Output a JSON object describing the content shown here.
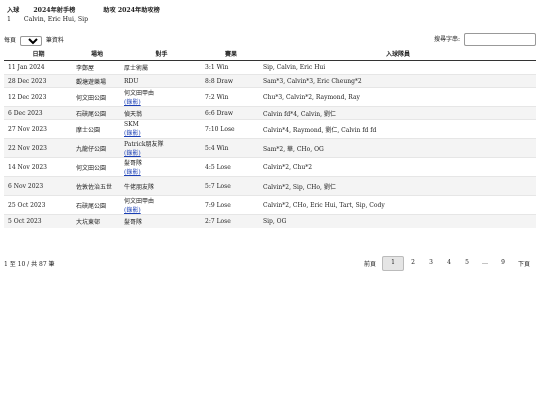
{
  "header": {
    "tab_goals": "入球",
    "tab_scorers": "2024年射手榜",
    "tab_assists": "助攻 2024年助攻榜",
    "rank": "1",
    "leaders": "Calvin, Eric Hui, Sip"
  },
  "controls": {
    "show_prefix": "每頁",
    "page_size": "10",
    "show_suffix": "筆資料",
    "search_label": "搜尋字串:"
  },
  "table": {
    "headers": [
      "日期",
      "場地",
      "對手",
      "賽果",
      "入球隊員"
    ],
    "rows": [
      {
        "date": "11 Jan 2024",
        "venue": "李鄭屋",
        "opponent": "厚士術屬",
        "link": "",
        "result": "3:1 Win",
        "scorers": "Sip, Calvin, Eric Hui"
      },
      {
        "date": "28 Dec 2023",
        "venue": "觀塘遊樂場",
        "opponent": "RDU",
        "link": "",
        "result": "8:8 Draw",
        "scorers": "Sam*3, Calvin*3, Eric Cheung*2"
      },
      {
        "date": "12 Dec 2023",
        "venue": "何文田公園",
        "opponent": "何文田甲由",
        "link": "(錄影)",
        "result": "7:2 Win",
        "scorers": "Chu*3, Calvin*2, Raymond, Ray"
      },
      {
        "date": "6 Dec 2023",
        "venue": "石硤尾公園",
        "opponent": "偵天翁",
        "link": "",
        "result": "6:6 Draw",
        "scorers": "Calvin fd*4, Calvin, 劉仁"
      },
      {
        "date": "27 Nov 2023",
        "venue": "摩士公園",
        "opponent": "SKM",
        "link": "(錄影)",
        "result": "7:10 Lose",
        "scorers": "Calvin*4, Raymond, 劉仁, Calvin fd fd"
      },
      {
        "date": "22 Nov 2023",
        "venue": "九龍仔公園",
        "opponent": "Patrick朋友隊",
        "link": "(錄影)",
        "result": "5:4 Win",
        "scorers": "Sam*2, 華, CHo, OG"
      },
      {
        "date": "14 Nov 2023",
        "venue": "何文田公園",
        "opponent": "髮哥隊",
        "link": "(錄影)",
        "result": "4:5 Lose",
        "scorers": "Calvin*2, Chu*2"
      },
      {
        "date": "6 Nov 2023",
        "venue": "佐敦佐治五世",
        "opponent": "牛佬朋友隊",
        "link": "",
        "result": "5:7 Lose",
        "scorers": "Calvin*2, Sip, CHo, 劉仁"
      },
      {
        "date": "25 Oct 2023",
        "venue": "石硤尾公園",
        "opponent": "何文田甲由",
        "link": "(錄影)",
        "result": "7:9 Lose",
        "scorers": "Calvin*2, CHo, Eric Hui, Tart, Sip, Cody"
      },
      {
        "date": "5 Oct 2023",
        "venue": "大坑東邨",
        "opponent": "髮哥隊",
        "link": "",
        "result": "2:7 Lose",
        "scorers": "Sip, OG"
      }
    ]
  },
  "footer": {
    "info": "1 至 10 / 共 87 筆",
    "prev": "前頁",
    "pages": [
      "1",
      "2",
      "3",
      "4",
      "5",
      "…",
      "9"
    ],
    "next": "下頁"
  }
}
